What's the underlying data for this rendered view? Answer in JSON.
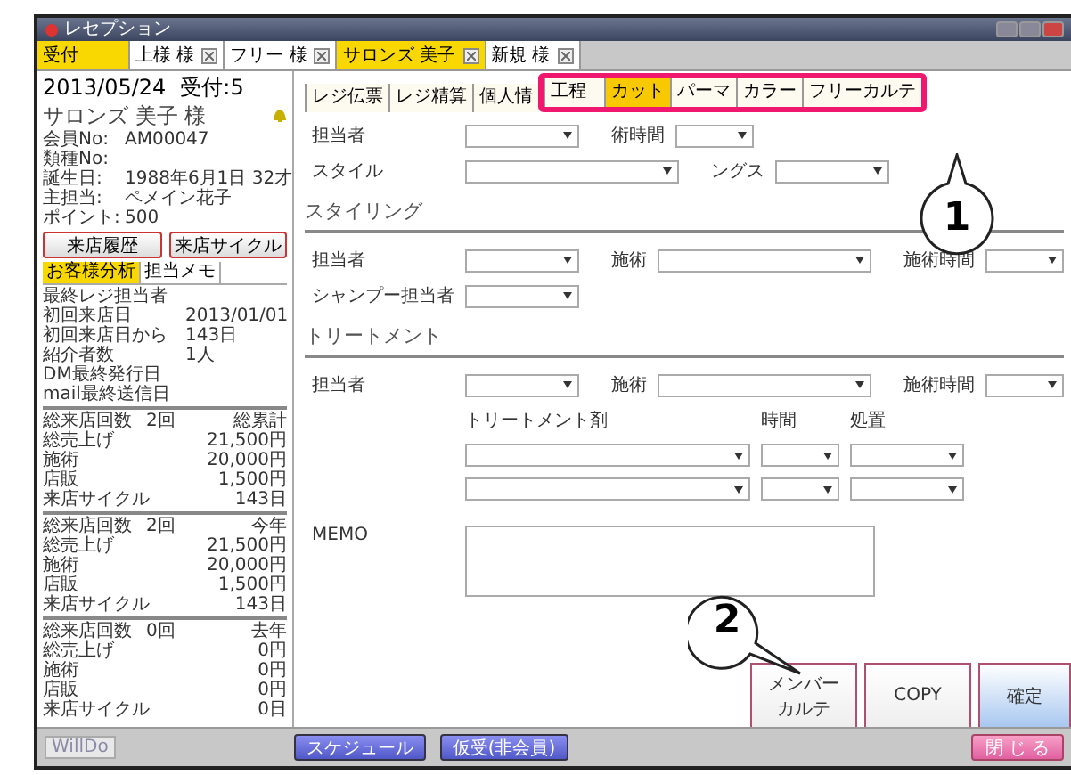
{
  "window": {
    "title": "レセプション"
  },
  "customer_tabs": [
    {
      "label": "受付",
      "selected": true,
      "closable": false
    },
    {
      "label": "上様 様",
      "selected": false,
      "closable": true
    },
    {
      "label": "フリー 様",
      "selected": false,
      "closable": true
    },
    {
      "label": "サロンズ 美子",
      "selected": true,
      "closable": true
    },
    {
      "label": "新規 様",
      "selected": false,
      "closable": true
    }
  ],
  "customer": {
    "date": "2013/05/24",
    "reception": "受付:5",
    "name": "サロンズ 美子 様",
    "info": [
      {
        "label": "会員No:",
        "value": "AM00047"
      },
      {
        "label": "類種No:"
      },
      {
        "label": "誕生日:",
        "value": "1988年6月1日 32才"
      },
      {
        "label": "主担当:",
        "value": "ペメイン花子"
      },
      {
        "label": "ポイント:",
        "value": "500"
      }
    ],
    "buttons": [
      "来店履歴",
      "来店サイクル"
    ],
    "tabs": [
      {
        "label": "お客様分析",
        "selected": true
      },
      {
        "label": "担当メモ",
        "selected": false
      }
    ],
    "analysis": [
      {
        "label": "最終レジ担当者"
      },
      {
        "label": "初回来店日",
        "value": "2013/01/01"
      },
      {
        "label": "初回来店日から",
        "value": "143日"
      },
      {
        "label": "紹介者数",
        "value": "1人"
      },
      {
        "label": "DM最終発行日"
      },
      {
        "label": "mail最終送信日"
      }
    ],
    "summaries": [
      {
        "count_label": "総来店回数",
        "count": "2回",
        "period": "総累計",
        "rows": [
          {
            "label": "総売上げ",
            "value": "21,500円"
          },
          {
            "label": "施術",
            "value": "20,000円"
          },
          {
            "label": "店販",
            "value": "1,500円"
          },
          {
            "label": "来店サイクル",
            "value": "143日"
          }
        ]
      },
      {
        "count_label": "総来店回数",
        "count": "2回",
        "period": "今年",
        "rows": [
          {
            "label": "総売上げ",
            "value": "21,500円"
          },
          {
            "label": "施術",
            "value": "20,000円"
          },
          {
            "label": "店販",
            "value": "1,500円"
          },
          {
            "label": "来店サイクル",
            "value": "143日"
          }
        ]
      },
      {
        "count_label": "総来店回数",
        "count": "0回",
        "period": "去年",
        "rows": [
          {
            "label": "総売上げ",
            "value": "0円"
          },
          {
            "label": "施術",
            "value": "0円"
          },
          {
            "label": "店販",
            "value": "0円"
          },
          {
            "label": "来店サイクル",
            "value": "0日"
          }
        ]
      }
    ]
  },
  "main_tabs": [
    {
      "label": "レジ伝票",
      "selected": false,
      "highlighted": false
    },
    {
      "label": "レジ精算",
      "selected": false,
      "highlighted": false
    },
    {
      "label": "個人情",
      "selected": false,
      "highlighted": false
    },
    {
      "label": "工程",
      "selected": false,
      "highlighted": true
    },
    {
      "label": "カット",
      "selected": true,
      "highlighted": true
    },
    {
      "label": "パーマ",
      "selected": false,
      "highlighted": true
    },
    {
      "label": "カラー",
      "selected": false,
      "highlighted": true
    },
    {
      "label": "フリーカルテ",
      "selected": false,
      "highlighted": true
    }
  ],
  "cut_form": {
    "rows": [
      [
        {
          "label": "担当者",
          "kind": "medium"
        },
        {
          "label": "術時間",
          "kind": "short"
        }
      ],
      [
        {
          "label": "スタイル",
          "kind": "wide"
        },
        {
          "label": "ングス",
          "kind": "medium"
        }
      ]
    ]
  },
  "styling": {
    "title": "スタイリング",
    "rows": [
      [
        {
          "label": "担当者",
          "kind": "medium"
        },
        {
          "label": "施術",
          "kind": "wide"
        },
        {
          "label": "施術時間",
          "kind": "short"
        }
      ],
      [
        {
          "label": "シャンプー担当者",
          "kind": "medium"
        }
      ]
    ]
  },
  "treatment": {
    "title": "トリートメント",
    "fields": [
      {
        "label": "担当者",
        "kind": "medium"
      },
      {
        "label": "施術",
        "kind": "wide"
      },
      {
        "label": "施術時間",
        "kind": "short"
      }
    ],
    "columns": [
      "トリートメント剤",
      "時間",
      "処置"
    ]
  },
  "memo": {
    "label": "MEMO"
  },
  "action_buttons": [
    {
      "label": "メンバーカルテ",
      "kind": "plain"
    },
    {
      "label": "COPY",
      "kind": "plain"
    },
    {
      "label": "確定",
      "kind": "primary"
    }
  ],
  "footer": {
    "logo": "WillDo",
    "buttons": [
      "スケジュール",
      "仮受(非会員)"
    ],
    "close": "閉 じ る"
  },
  "callouts": [
    {
      "number": "1"
    },
    {
      "number": "2"
    }
  ]
}
